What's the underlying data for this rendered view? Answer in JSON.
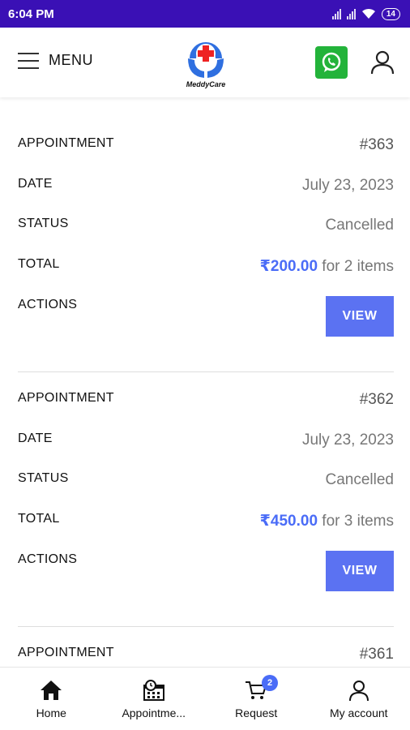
{
  "status_bar": {
    "time": "6:04 PM",
    "battery": "14"
  },
  "header": {
    "menu_label": "MENU",
    "logo_text": "MeddyCare"
  },
  "appointments": [
    {
      "labels": {
        "appointment": "APPOINTMENT",
        "date": "DATE",
        "status": "STATUS",
        "total": "TOTAL",
        "actions": "ACTIONS"
      },
      "number": "#363",
      "date": "July 23, 2023",
      "status": "Cancelled",
      "price": "₹200.00",
      "items": "for 2 items",
      "action_label": "VIEW"
    },
    {
      "labels": {
        "appointment": "APPOINTMENT",
        "date": "DATE",
        "status": "STATUS",
        "total": "TOTAL",
        "actions": "ACTIONS"
      },
      "number": "#362",
      "date": "July 23, 2023",
      "status": "Cancelled",
      "price": "₹450.00",
      "items": "for 3 items",
      "action_label": "VIEW"
    },
    {
      "labels": {
        "appointment": "APPOINTMENT"
      },
      "number": "#361"
    }
  ],
  "bottom_nav": {
    "items": [
      {
        "label": "Home",
        "icon": "home-icon"
      },
      {
        "label": "Appointme...",
        "icon": "appointment-calendar-icon"
      },
      {
        "label": "Request",
        "icon": "cart-icon",
        "badge": "2"
      },
      {
        "label": "My account",
        "icon": "user-icon"
      }
    ]
  },
  "colors": {
    "status_bar": "#3a10b5",
    "accent": "#5b72f2",
    "price": "#4a6cf7",
    "whatsapp": "#23b33a"
  }
}
